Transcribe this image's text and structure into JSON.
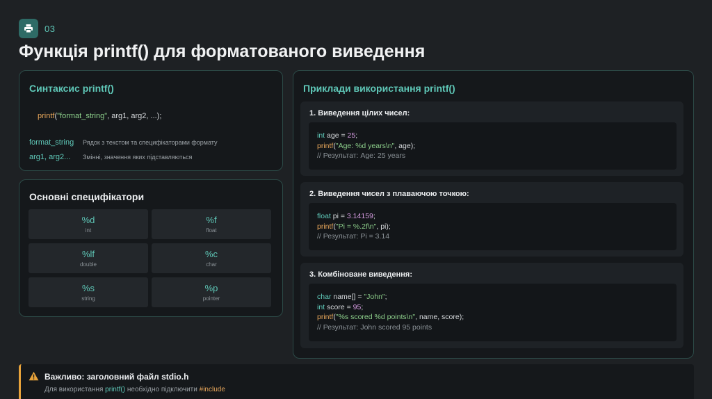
{
  "header": {
    "icon": "printer-icon",
    "number": "03",
    "title": "Функція printf() для форматованого виведення"
  },
  "syntax": {
    "title": "Синтаксис printf()",
    "code": {
      "fn": "printf",
      "open": "(",
      "str": "\"format_string\"",
      "rest": ", arg1, arg2, ...);"
    },
    "params": [
      {
        "name": "format_string",
        "desc": "Рядок з текстом та специфікаторами формату"
      },
      {
        "name": "arg1, arg2...",
        "desc": "Змінні, значення яких підставляються"
      }
    ]
  },
  "specifiers": {
    "title": "Основні специфікатори",
    "items": [
      {
        "code": "%d",
        "type": "int"
      },
      {
        "code": "%f",
        "type": "float"
      },
      {
        "code": "%lf",
        "type": "double"
      },
      {
        "code": "%c",
        "type": "char"
      },
      {
        "code": "%s",
        "type": "string"
      },
      {
        "code": "%p",
        "type": "pointer"
      }
    ]
  },
  "examples": {
    "title": "Приклади використання printf()",
    "items": [
      {
        "title": "1. Виведення цілих чисел:",
        "l1_kw": "int",
        "l1_a": " age = ",
        "l1_num": "25",
        "l1_b": ";",
        "l2_fn": "printf",
        "l2_a": "(",
        "l2_str": "\"Age: %d years\\n\"",
        "l2_b": ", age);",
        "comment": "// Результат: Age: 25 years"
      },
      {
        "title": "2. Виведення чисел з плаваючою точкою:",
        "l1_kw": "float",
        "l1_a": " pi = ",
        "l1_num": "3.14159",
        "l1_b": ";",
        "l2_fn": "printf",
        "l2_a": "(",
        "l2_str": "\"Pi = %.2f\\n\"",
        "l2_b": ", pi);",
        "comment": "// Результат: Pi = 3.14"
      },
      {
        "title": "3. Комбіноване виведення:",
        "l1_kw": "char",
        "l1_a": " name[] = ",
        "l1_str": "\"John\"",
        "l1_b": ";",
        "l2_kw": "int",
        "l2_a": " score = ",
        "l2_num": "95",
        "l2_b": ";",
        "l3_fn": "printf",
        "l3_a": "(",
        "l3_str": "\"%s scored %d points\\n\"",
        "l3_b": ", name, score);",
        "comment": "// Результат: John scored 95 points"
      }
    ]
  },
  "note": {
    "icon": "warning-icon",
    "title": "Важливо: заголовний файл stdio.h",
    "text_a": "Для використання ",
    "text_fn": "printf()",
    "text_b": " необхідно підключити ",
    "text_inc": "#include"
  },
  "colors": {
    "accent": "#5fc8b8",
    "warning": "#e8a33b",
    "function": "#e6a55a",
    "string": "#8dcf8b",
    "number": "#d59be0"
  }
}
